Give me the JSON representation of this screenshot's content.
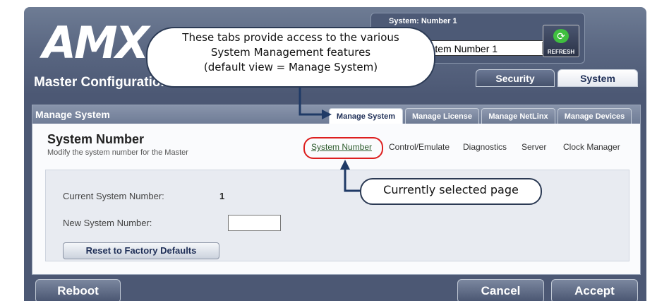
{
  "header": {
    "logo": "AMX",
    "title": "Master Configuration",
    "system_caption": "System: Number 1",
    "system_select_value": "System Number 1",
    "refresh_label": "REFRESH"
  },
  "main_tabs": [
    {
      "label": "Security"
    },
    {
      "label": "System",
      "active": true
    }
  ],
  "section_header": "Manage System",
  "sub_tabs": [
    {
      "label": "Manage System",
      "active": true
    },
    {
      "label": "Manage License"
    },
    {
      "label": "Manage NetLinx"
    },
    {
      "label": "Manage Devices"
    }
  ],
  "page": {
    "title": "System Number",
    "subtitle": "Modify the system number for the Master",
    "links": [
      {
        "label": "System Number",
        "active": true
      },
      {
        "label": "Control/Emulate"
      },
      {
        "label": "Diagnostics"
      },
      {
        "label": "Server"
      },
      {
        "label": "Clock Manager"
      }
    ]
  },
  "form": {
    "current_label": "Current System Number:",
    "current_value": "1",
    "new_label": "New System Number:",
    "new_value": "",
    "reset_button": "Reset to Factory Defaults"
  },
  "footer": {
    "reboot": "Reboot",
    "cancel": "Cancel",
    "accept": "Accept"
  },
  "callouts": {
    "tabs_line1": "These tabs provide access to the various",
    "tabs_line2": "System Management features",
    "tabs_line3": "(default view = Manage System)",
    "page_note": "Currently selected page"
  },
  "colors": {
    "frame": "#5a6782",
    "highlight_ring": "#dd1f1f",
    "arrow": "#1f3a66"
  }
}
